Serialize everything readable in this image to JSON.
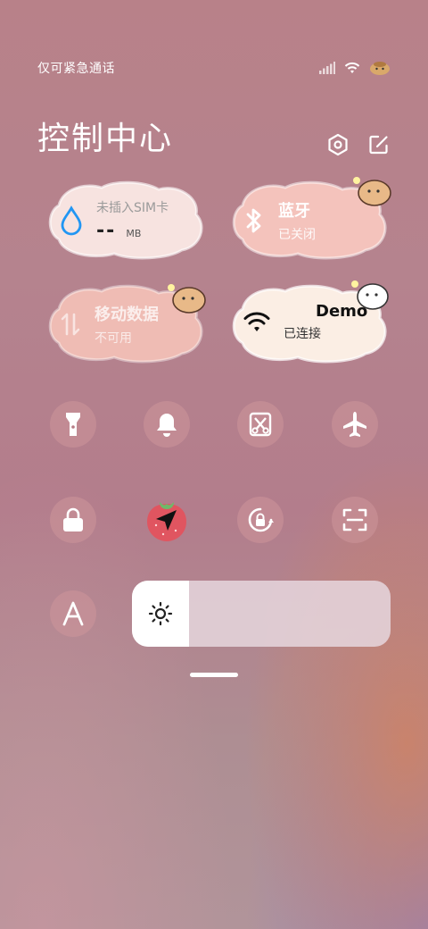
{
  "status_bar": {
    "carrier_text": "仅可紧急通话",
    "icons": [
      "signal-icon",
      "wifi-icon",
      "mascot-battery-icon"
    ]
  },
  "header": {
    "title": "控制中心",
    "actions": [
      "settings-hexagon-icon",
      "edit-icon"
    ]
  },
  "tiles": {
    "data": {
      "label": "未插入SIM卡",
      "value": "--",
      "unit": "MB",
      "icon": "water-drop-icon"
    },
    "bluetooth": {
      "title": "蓝牙",
      "status": "已关闭",
      "icon": "bluetooth-icon"
    },
    "mobile_data": {
      "title": "移动数据",
      "status": "不可用",
      "icon": "data-arrows-icon"
    },
    "wifi": {
      "title": "Demo",
      "status": "已连接",
      "icon": "wifi-icon"
    }
  },
  "toggles": [
    {
      "name": "flashlight",
      "icon": "flashlight-icon",
      "active": false
    },
    {
      "name": "bell",
      "icon": "bell-icon",
      "active": false
    },
    {
      "name": "screenshot",
      "icon": "scissors-icon",
      "active": false
    },
    {
      "name": "airplane",
      "icon": "airplane-icon",
      "active": false
    },
    {
      "name": "lock",
      "icon": "lock-icon",
      "active": false
    },
    {
      "name": "location",
      "icon": "location-arrow-icon",
      "active": true
    },
    {
      "name": "rotation",
      "icon": "rotation-lock-icon",
      "active": false
    },
    {
      "name": "scan",
      "icon": "scan-icon",
      "active": false
    },
    {
      "name": "font",
      "icon": "font-a-icon",
      "active": false
    }
  ],
  "brightness": {
    "level": 0.22,
    "icon": "sun-icon"
  },
  "colors": {
    "accent": "#2196f3",
    "active_berry": "#e05560"
  }
}
